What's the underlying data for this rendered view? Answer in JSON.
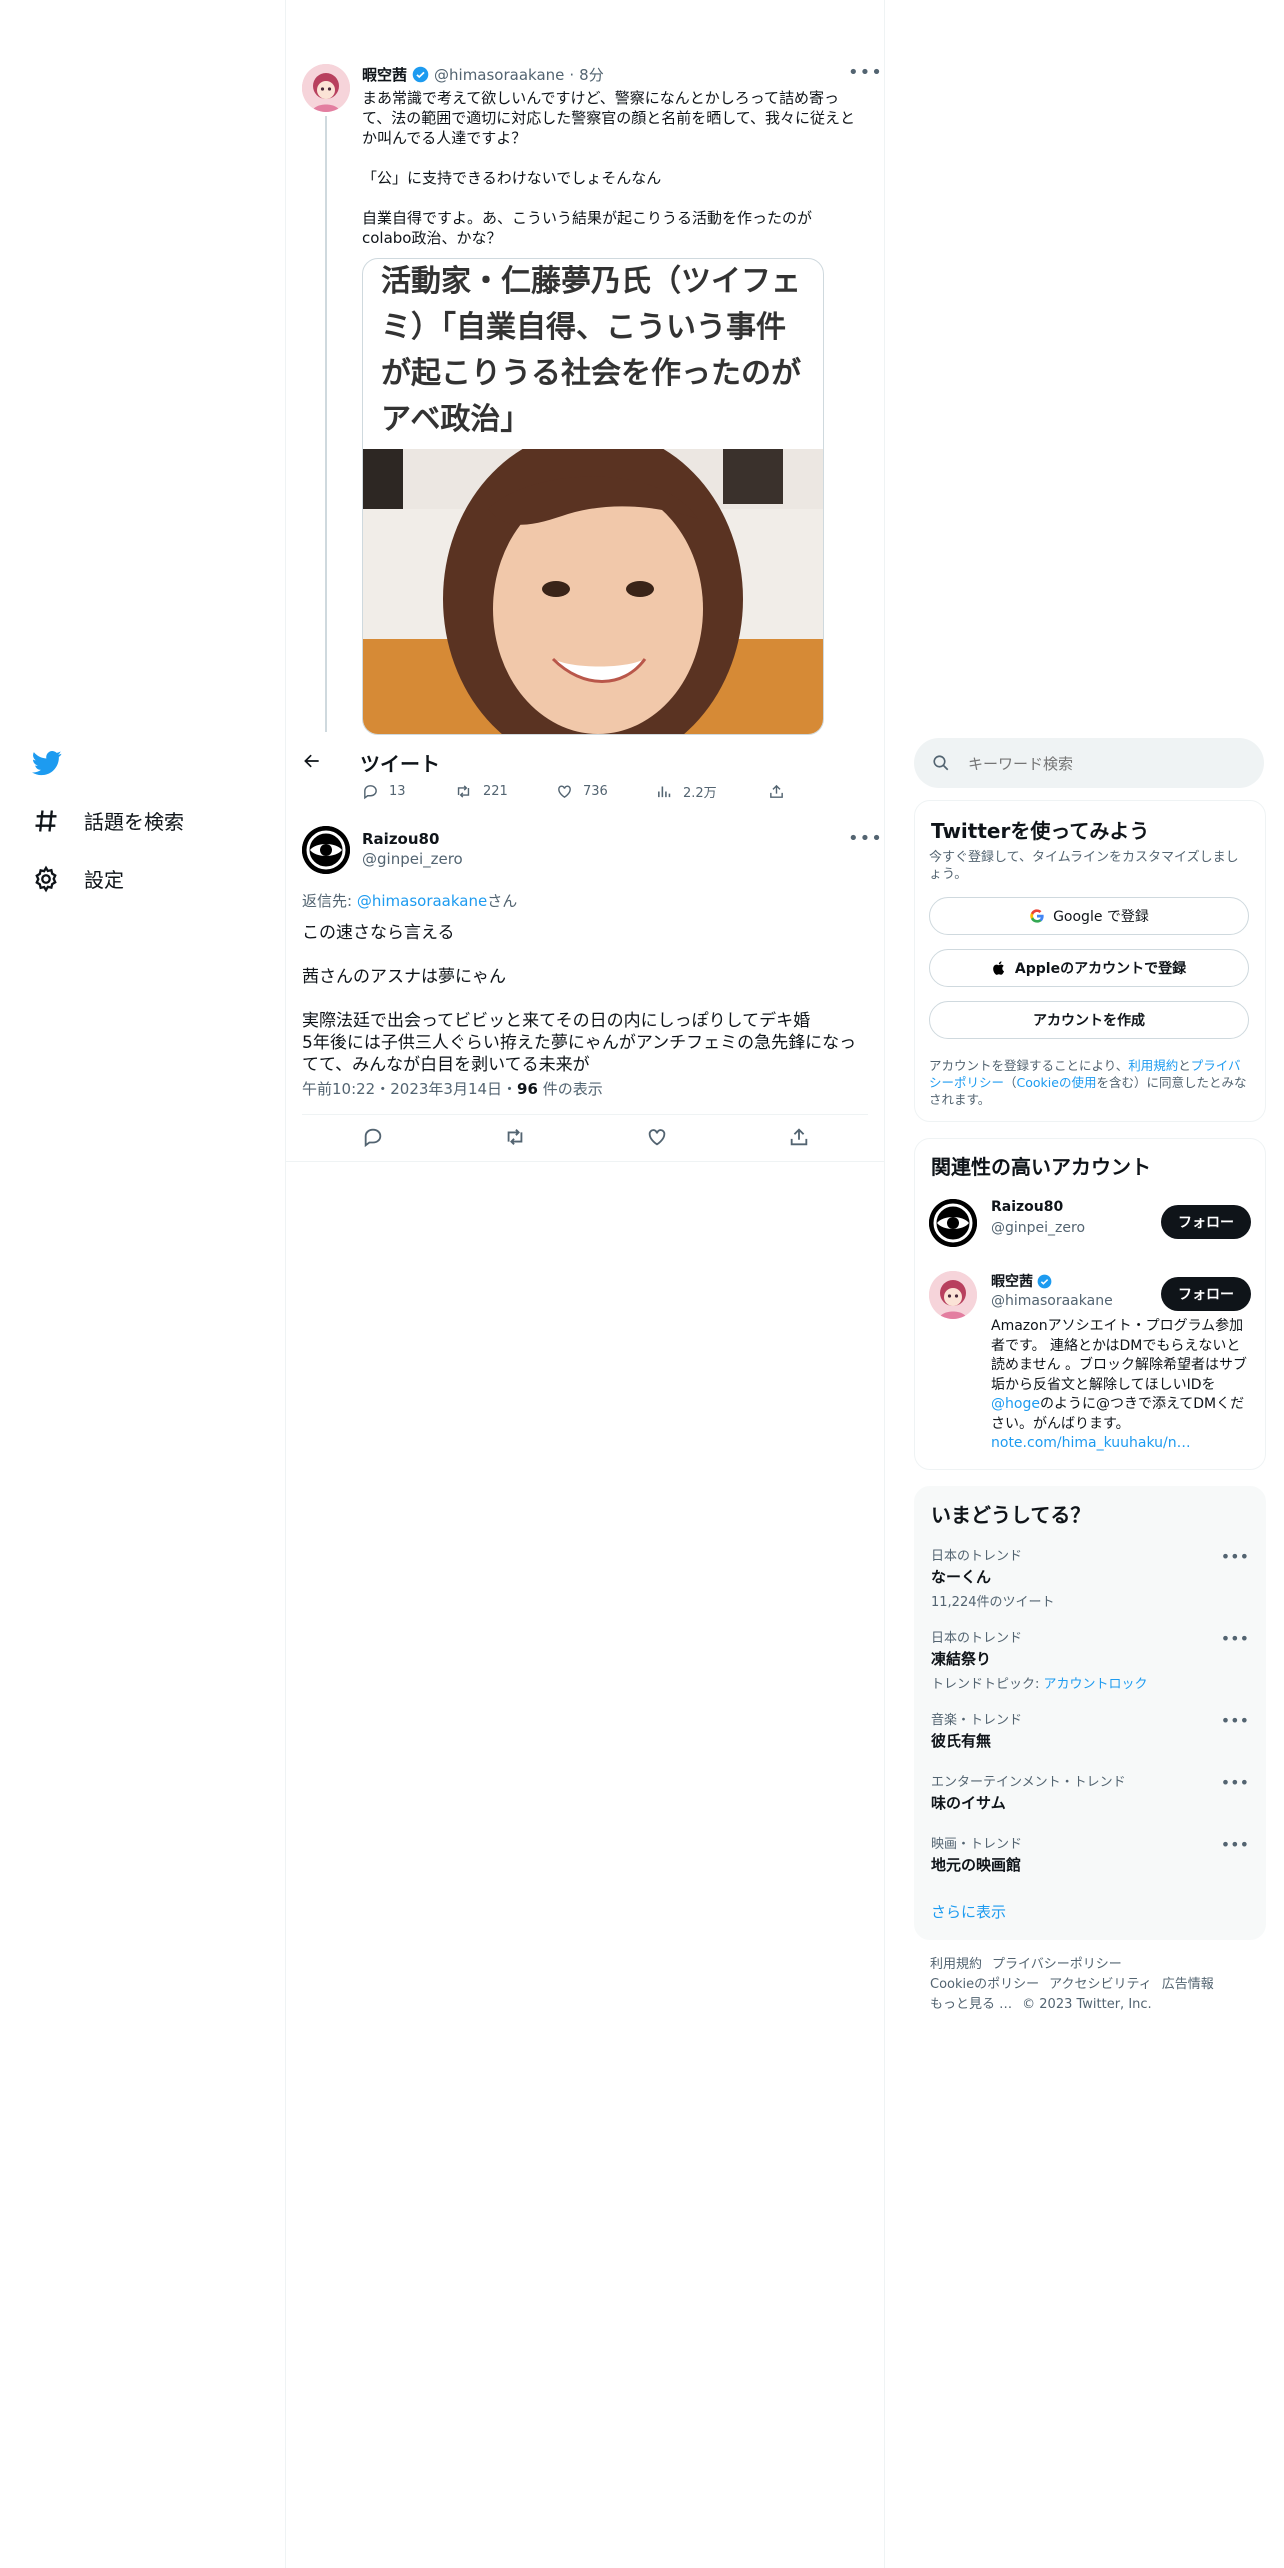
{
  "nav": {
    "items": [
      {
        "label": "話題を検索",
        "icon": "hashtag-icon"
      },
      {
        "label": "設定",
        "icon": "gear-icon"
      }
    ]
  },
  "header": {
    "title": "ツイート"
  },
  "parent_tweet": {
    "name": "暇空茜",
    "handle": "@himasoraakane",
    "time": "8分",
    "text": "まあ常識で考えて欲しいんですけど、警察になんとかしろって詰め寄って、法の範囲で適切に対応した警察官の顔と名前を晒して、我々に従えとか叫んでる人達ですよ？\n\n「公」に支持できるわけないでしょそんなん\n\n自業自得ですよ。あ、こういう結果が起こりうる活動を作ったのがcolabo政治、かな？",
    "card_title": "活動家・仁藤夢乃氏（ツイフェミ）「自業自得、こういう事件が起こりうる社会を作ったのがアベ政治」",
    "stats": {
      "replies": "13",
      "retweets": "221",
      "likes": "736",
      "views": "2.2万"
    }
  },
  "main_tweet": {
    "name": "Raizou80",
    "handle": "@ginpei_zero",
    "reply_prefix": "返信先:",
    "reply_to": "@himasoraakane",
    "reply_suffix": "さん",
    "text": "この速さなら言える\n\n茜さんのアスナは夢にゃん\n\n実際法廷で出会ってビビッと来てその日の内にしっぽりしてデキ婚\n5年後には子供三人ぐらい拵えた夢にゃんがアンチフェミの急先鋒になってて、みんなが白目を剥いてる未来が",
    "timestamp": "午前10:22・2023年3月14日・",
    "views_count": "96",
    "views_label": "件の表示"
  },
  "search": {
    "placeholder": "キーワード検索"
  },
  "signup": {
    "title": "Twitterを使ってみよう",
    "subtitle": "今すぐ登録して、タイムラインをカスタマイズしましょう。",
    "google_label": "Google で登録",
    "apple_label": "Appleのアカウントで登録",
    "create_label": "アカウントを作成",
    "terms_pre": "アカウントを登録することにより、",
    "terms_link1": "利用規約",
    "terms_mid1": "と",
    "terms_link2": "プライバシーポリシー",
    "terms_mid2": "（",
    "terms_link3": "Cookieの使用",
    "terms_post": "を含む）に同意したとみなされます。"
  },
  "relevant": {
    "title": "関連性の高いアカウント",
    "accounts": [
      {
        "name": "Raizou80",
        "handle": "@ginpei_zero",
        "follow": "フォロー"
      },
      {
        "name": "暇空茜",
        "handle": "@himasoraakane",
        "follow": "フォロー",
        "bio_pre": "Amazonアソシエイト・プログラム参加者です。 連絡とかはDMでもらえないと読めません 。ブロック解除希望者はサブ垢から反省文と解除してほしいIDを",
        "bio_link": "@hoge",
        "bio_mid": "のように@つきで添えてDMください。がんばります。",
        "bio_url": "note.com/hima_kuuhaku/n…"
      }
    ]
  },
  "trends": {
    "title": "いまどうしてる？",
    "items": [
      {
        "category": "日本のトレンド",
        "name": "なーくん",
        "sub": "11,224件のツイート"
      },
      {
        "category": "日本のトレンド",
        "name": "凍結祭り",
        "sub_pre": "トレンドトピック: ",
        "sub_link": "アカウントロック"
      },
      {
        "category": "音楽・トレンド",
        "name": "彼氏有無"
      },
      {
        "category": "エンターテインメント・トレンド",
        "name": "味のイサム"
      },
      {
        "category": "映画・トレンド",
        "name": "地元の映画館"
      }
    ],
    "show_more": "さらに表示"
  },
  "footer": {
    "links": [
      "利用規約",
      "プライバシーポリシー",
      "Cookieのポリシー",
      "アクセシビリティ",
      "広告情報",
      "もっと見る …"
    ],
    "copyright": "© 2023 Twitter, Inc."
  },
  "colors": {
    "twitter_blue": "#1d9bf0",
    "text": "#0f1419",
    "muted": "#536471"
  }
}
